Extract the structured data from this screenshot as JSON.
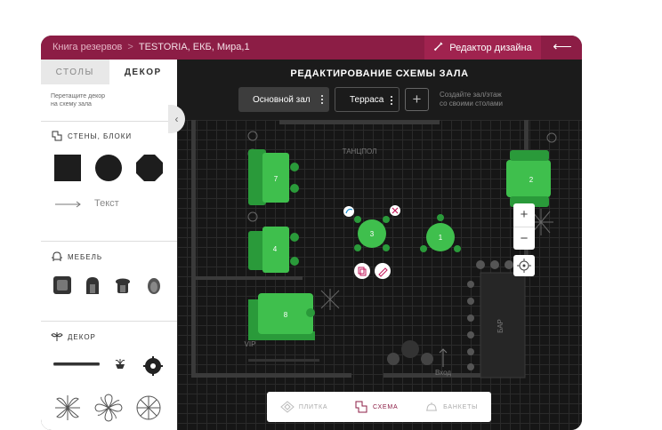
{
  "breadcrumb": {
    "root": "Книга резервов",
    "separator": ">",
    "current": "TESTORIA, ЕКБ, Мира,1"
  },
  "header_actions": {
    "design_editor": "Редактор дизайна",
    "back_icon": "arrow-left-icon"
  },
  "sidebar": {
    "tabs": [
      {
        "label": "СТОЛЫ",
        "active": false
      },
      {
        "label": "ДЕКОР",
        "active": true
      }
    ],
    "hint": [
      "Перетащите декор",
      "на схему зала"
    ],
    "walls_section": {
      "title": "СТЕНЫ, БЛОКИ",
      "shapes": [
        "square-block",
        "circle-block",
        "octagon-block"
      ],
      "line_label": "Текст"
    },
    "furniture_section": {
      "title": "МЕБЕЛЬ",
      "items": [
        "armchair-icon",
        "chair-icon",
        "stool-icon",
        "seat-icon"
      ]
    },
    "decor_section": {
      "title": "ДЕКОР",
      "items": [
        "shelf-icon",
        "plant-pot-icon",
        "lamp-icon",
        "leaf-icon",
        "flower-icon",
        "monstera-icon"
      ]
    }
  },
  "editor": {
    "title": "РЕДАКТИРОВАНИЕ СХЕМЫ ЗАЛА",
    "halls": [
      "Основной зал",
      "Терраса"
    ],
    "create_hint": [
      "Создайте зал/этаж",
      "со своими столами"
    ]
  },
  "floor_plan": {
    "zones": {
      "dance": "ТАНЦПОЛ",
      "vip": "VIP",
      "bar": "БАР",
      "entrance": "Вход"
    },
    "tables": [
      "7",
      "4",
      "8",
      "3",
      "1",
      "2"
    ],
    "colors": {
      "table": "#2a9a3a",
      "table_light": "#3fbf4d",
      "wall": "#3a3a3a",
      "selection_blue": "#1a8fd0",
      "accent": "#8c1d45"
    }
  },
  "zoom": {
    "in": "+",
    "out": "−"
  },
  "modes": [
    {
      "label": "ПЛИТКА",
      "icon": "tile-icon",
      "active": false
    },
    {
      "label": "СХЕМА",
      "icon": "scheme-icon",
      "active": true
    },
    {
      "label": "БАНКЕТЫ",
      "icon": "banquet-icon",
      "active": false
    }
  ]
}
